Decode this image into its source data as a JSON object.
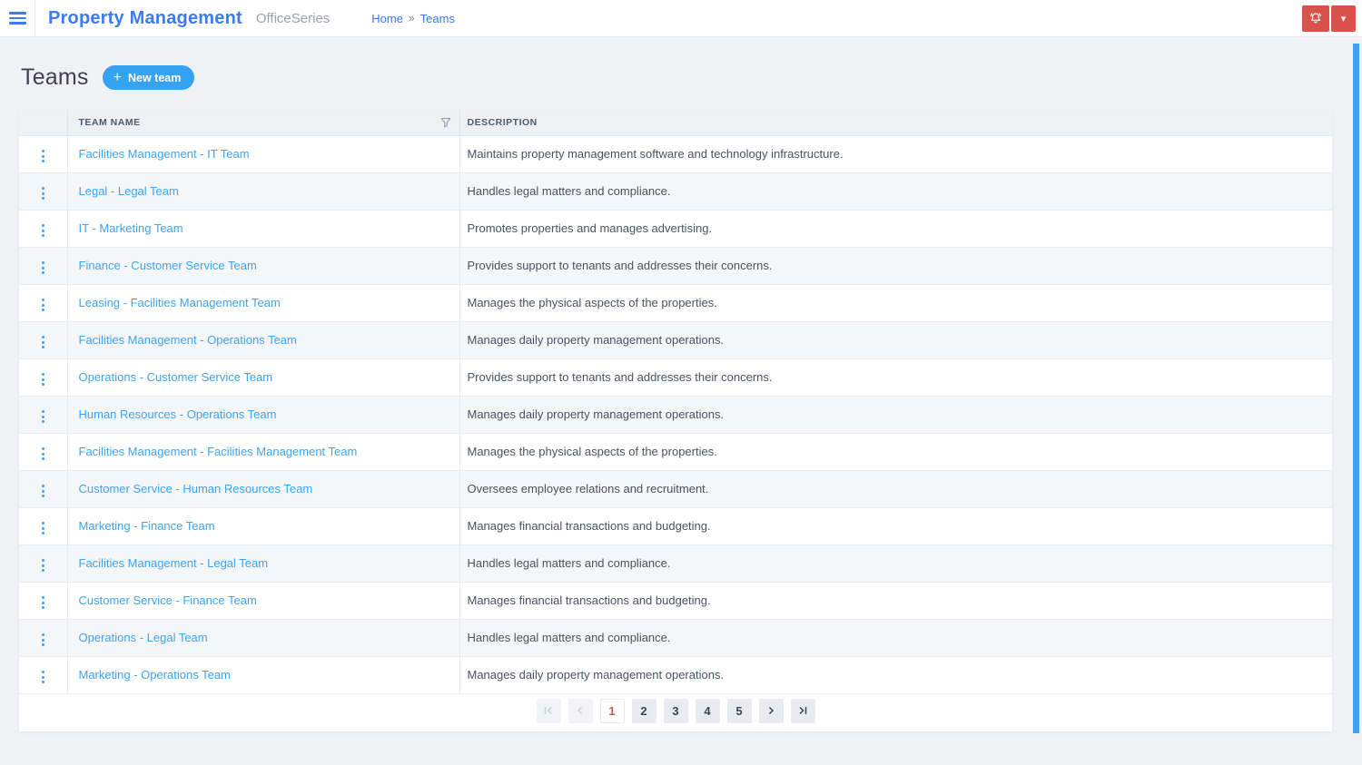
{
  "header": {
    "app_title": "Property Management",
    "app_subtitle": "OfficeSeries",
    "breadcrumb": {
      "home": "Home",
      "separator": "»",
      "current": "Teams"
    }
  },
  "page": {
    "title": "Teams",
    "new_team_button": "New team"
  },
  "icons": {
    "plus": "+",
    "caret_down": "▾"
  },
  "table": {
    "columns": {
      "team_name": "TEAM NAME",
      "description": "DESCRIPTION"
    },
    "rows": [
      {
        "name": "Facilities Management - IT Team",
        "description": "Maintains property management software and technology infrastructure."
      },
      {
        "name": "Legal - Legal Team",
        "description": "Handles legal matters and compliance."
      },
      {
        "name": "IT - Marketing Team",
        "description": "Promotes properties and manages advertising."
      },
      {
        "name": "Finance - Customer Service Team",
        "description": "Provides support to tenants and addresses their concerns."
      },
      {
        "name": "Leasing - Facilities Management Team",
        "description": "Manages the physical aspects of the properties."
      },
      {
        "name": "Facilities Management - Operations Team",
        "description": "Manages daily property management operations."
      },
      {
        "name": "Operations - Customer Service Team",
        "description": "Provides support to tenants and addresses their concerns."
      },
      {
        "name": "Human Resources - Operations Team",
        "description": "Manages daily property management operations."
      },
      {
        "name": "Facilities Management - Facilities Management Team",
        "description": "Manages the physical aspects of the properties."
      },
      {
        "name": "Customer Service - Human Resources Team",
        "description": "Oversees employee relations and recruitment."
      },
      {
        "name": "Marketing - Finance Team",
        "description": "Manages financial transactions and budgeting."
      },
      {
        "name": "Facilities Management - Legal Team",
        "description": "Handles legal matters and compliance."
      },
      {
        "name": "Customer Service - Finance Team",
        "description": "Manages financial transactions and budgeting."
      },
      {
        "name": "Operations - Legal Team",
        "description": "Handles legal matters and compliance."
      },
      {
        "name": "Marketing - Operations Team",
        "description": "Manages daily property management operations."
      }
    ]
  },
  "pagination": {
    "pages": [
      "1",
      "2",
      "3",
      "4",
      "5"
    ],
    "active_page": "1"
  },
  "colors": {
    "accent_blue": "#3d7bf4",
    "link_blue": "#3da3f3",
    "button_blue": "#35a3f1",
    "alert_red": "#d9514b",
    "active_page_red": "#de4f47",
    "scrollbar_blue": "#41a0f8"
  }
}
